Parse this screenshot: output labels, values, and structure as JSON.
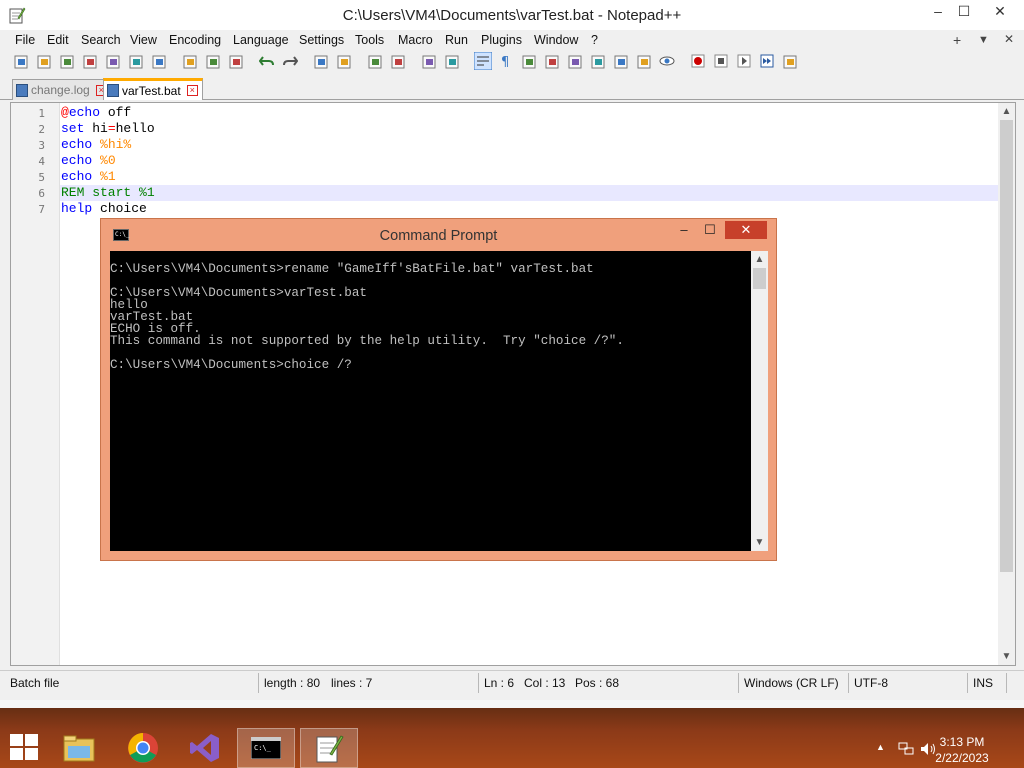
{
  "window": {
    "title": "C:\\Users\\VM4\\Documents\\varTest.bat - Notepad++",
    "minimize": "–",
    "maximize": "☐",
    "close": "✕"
  },
  "menu": [
    "File",
    "Edit",
    "Search",
    "View",
    "Encoding",
    "Language",
    "Settings",
    "Tools",
    "Macro",
    "Run",
    "Plugins",
    "Window",
    "?"
  ],
  "menu_right": {
    "plus": "+",
    "down": "▼",
    "close": "✕"
  },
  "toolbar_icons": [
    "new-file-icon",
    "open-file-icon",
    "save-icon",
    "save-all-icon",
    "close-icon",
    "close-all-icon",
    "print-icon",
    "cut-icon",
    "copy-icon",
    "paste-icon",
    "undo-icon",
    "redo-icon",
    "find-icon",
    "replace-icon",
    "zoom-in-icon",
    "zoom-out-icon",
    "sync-vertical-icon",
    "sync-horizontal-icon",
    "word-wrap-icon",
    "show-all-chars-icon",
    "indent-guide-icon",
    "udl-icon",
    "doc-map-icon",
    "function-list-icon",
    "folder-workspace-icon",
    "monitor-icon",
    "eye-icon",
    "record-macro-icon",
    "stop-macro-icon",
    "play-macro-icon",
    "run-macro-multiple-icon",
    "save-macro-icon"
  ],
  "tabs": [
    {
      "label": "change.log",
      "active": false
    },
    {
      "label": "varTest.bat",
      "active": true
    }
  ],
  "editor": {
    "lines": [
      {
        "n": "1",
        "tokens": [
          {
            "t": "@",
            "c": "op"
          },
          {
            "t": "echo",
            "c": "kw"
          },
          {
            "t": " off",
            "c": "txt"
          }
        ]
      },
      {
        "n": "2",
        "tokens": [
          {
            "t": "set",
            "c": "kw"
          },
          {
            "t": " hi",
            "c": "txt"
          },
          {
            "t": "=",
            "c": "op"
          },
          {
            "t": "hello",
            "c": "txt"
          }
        ]
      },
      {
        "n": "3",
        "tokens": [
          {
            "t": "echo",
            "c": "kw"
          },
          {
            "t": " ",
            "c": "txt"
          },
          {
            "t": "%hi%",
            "c": "var"
          }
        ]
      },
      {
        "n": "4",
        "tokens": [
          {
            "t": "echo",
            "c": "kw"
          },
          {
            "t": " ",
            "c": "txt"
          },
          {
            "t": "%0",
            "c": "var"
          }
        ]
      },
      {
        "n": "5",
        "tokens": [
          {
            "t": "echo",
            "c": "kw"
          },
          {
            "t": " ",
            "c": "txt"
          },
          {
            "t": "%1",
            "c": "var"
          }
        ]
      },
      {
        "n": "6",
        "tokens": [
          {
            "t": "REM start %1",
            "c": "cmt"
          }
        ],
        "current": true
      },
      {
        "n": "7",
        "tokens": [
          {
            "t": "help",
            "c": "kw"
          },
          {
            "t": " choice",
            "c": "txt"
          }
        ]
      }
    ]
  },
  "status": {
    "filetype": "Batch file",
    "length": "length : 80",
    "lines": "lines : 7",
    "ln": "Ln : 6",
    "col": "Col : 13",
    "pos": "Pos : 68",
    "eol": "Windows (CR LF)",
    "encoding": "UTF-8",
    "mode": "INS"
  },
  "cmd": {
    "title": "Command Prompt",
    "minimize": "–",
    "maximize": "☐",
    "close": "✕",
    "lines": [
      "C:\\Users\\VM4\\Documents>rename \"GameIff'sBatFile.bat\" varTest.bat",
      "",
      "C:\\Users\\VM4\\Documents>varTest.bat",
      "hello",
      "varTest.bat",
      "ECHO is off.",
      "This command is not supported by the help utility.  Try \"choice /?\".",
      "",
      "C:\\Users\\VM4\\Documents>choice /?"
    ]
  },
  "taskbar": {
    "time": "3:13 PM",
    "date": "2/22/2023",
    "apps": [
      "file-explorer-icon",
      "chrome-icon",
      "visual-studio-icon",
      "command-prompt-icon",
      "notepad-plus-plus-icon"
    ]
  },
  "colors": {
    "keyword": "#0000ff",
    "variable": "#ff8000",
    "operator": "#ff0000",
    "comment": "#008000",
    "current_line": "#e8e8ff",
    "cmd_frame": "#f0a07c",
    "cmd_close": "#c7402a",
    "taskbar": "#8c3a18"
  }
}
